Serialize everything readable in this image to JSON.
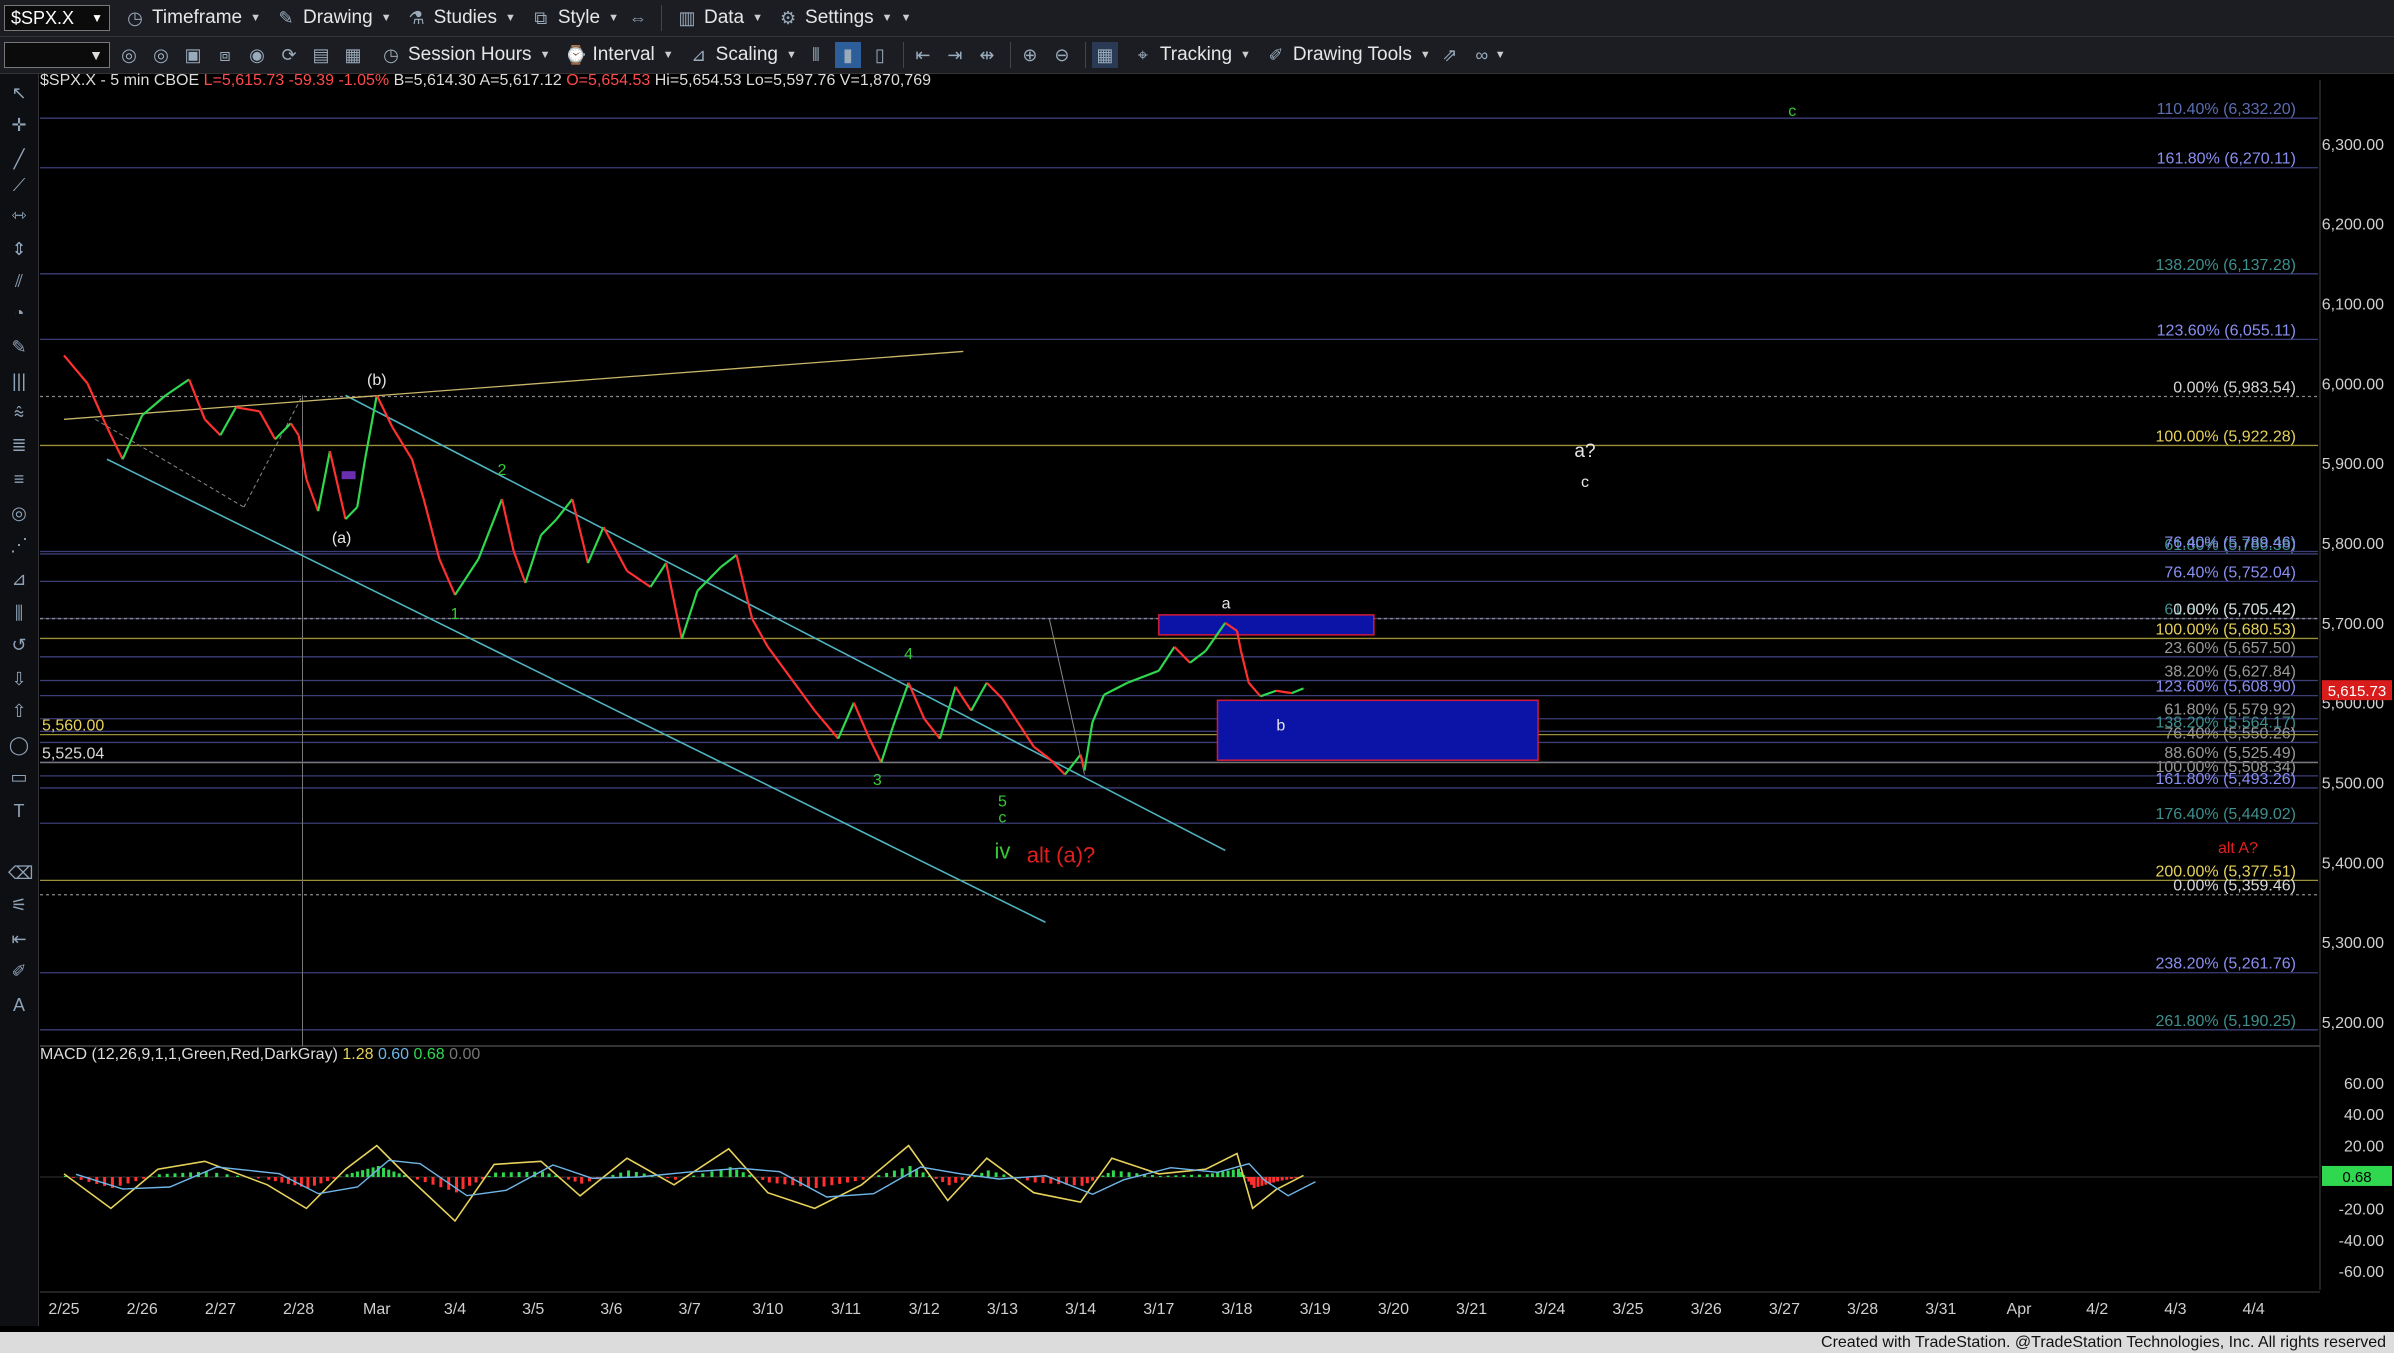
{
  "toolbar": {
    "symbol": "$SPX.X",
    "timeframe": "Timeframe",
    "drawing": "Drawing",
    "studies": "Studies",
    "style": "Style",
    "data": "Data",
    "settings": "Settings",
    "session_hours": "Session Hours",
    "interval": "Interval",
    "scaling": "Scaling",
    "tracking": "Tracking",
    "drawing_tools": "Drawing Tools"
  },
  "header": {
    "symbol_line": "$SPX.X - 5 min  CBOE",
    "last": "L=5,615.73",
    "change": "-59.39",
    "change_pct": "-1.05%",
    "bid": "B=5,614.30",
    "ask": "A=5,617.12",
    "open": "O=5,654.53",
    "high": "Hi=5,654.53",
    "low": "Lo=5,597.76",
    "volume": "V=1,870,769"
  },
  "colors": {
    "up": "#2fd84f",
    "down": "#ff3030",
    "trend": "#4fb3bf",
    "fib": "#3c3e78",
    "box": "#0c14a8",
    "box_edge": "#d01c3c",
    "label_white": "#e6e6e6",
    "label_green": "#37c837",
    "label_red": "#e02020",
    "price_tag": "#d81b1b",
    "macd_tag": "#2fd84f"
  },
  "chart_data": [
    {
      "type": "line",
      "title": "$SPX.X - 5 min",
      "x_ticks": [
        "2/25",
        "2/26",
        "2/27",
        "2/28",
        "Mar",
        "3/4",
        "3/5",
        "3/6",
        "3/7",
        "3/10",
        "3/11",
        "3/12",
        "3/13",
        "3/14",
        "3/17",
        "3/18",
        "3/19",
        "3/20",
        "3/21",
        "3/24",
        "3/25",
        "3/26",
        "3/27",
        "3/28",
        "3/31",
        "Apr",
        "4/2",
        "4/3",
        "4/4"
      ],
      "y_ticks": [
        5200,
        5300,
        5400,
        5500,
        5600,
        5700,
        5800,
        5900,
        6000,
        6100,
        6200,
        6300
      ],
      "y_tick_labels": [
        "5,200.00",
        "5,300.00",
        "5,400.00",
        "5,500.00",
        "5,600.00",
        "5,700.00",
        "5,800.00",
        "5,900.00",
        "6,000.00",
        "6,100.00",
        "6,200.00",
        "6,300.00"
      ],
      "ylim": [
        5170,
        6370
      ],
      "price_path": [
        {
          "x": 0.0,
          "y": 6035
        },
        {
          "x": 0.3,
          "y": 6000
        },
        {
          "x": 0.55,
          "y": 5945
        },
        {
          "x": 0.75,
          "y": 5905
        },
        {
          "x": 1.0,
          "y": 5960
        },
        {
          "x": 1.3,
          "y": 5985
        },
        {
          "x": 1.6,
          "y": 6005
        },
        {
          "x": 1.8,
          "y": 5955
        },
        {
          "x": 2.0,
          "y": 5935
        },
        {
          "x": 2.2,
          "y": 5970
        },
        {
          "x": 2.5,
          "y": 5965
        },
        {
          "x": 2.7,
          "y": 5930
        },
        {
          "x": 2.9,
          "y": 5950
        },
        {
          "x": 3.0,
          "y": 5935
        },
        {
          "x": 3.1,
          "y": 5880
        },
        {
          "x": 3.25,
          "y": 5840
        },
        {
          "x": 3.4,
          "y": 5915
        },
        {
          "x": 3.6,
          "y": 5830
        },
        {
          "x": 3.75,
          "y": 5845
        },
        {
          "x": 3.85,
          "y": 5905
        },
        {
          "x": 4.0,
          "y": 5985
        },
        {
          "x": 4.2,
          "y": 5945
        },
        {
          "x": 4.45,
          "y": 5905
        },
        {
          "x": 4.6,
          "y": 5855
        },
        {
          "x": 4.8,
          "y": 5780
        },
        {
          "x": 5.0,
          "y": 5735
        },
        {
          "x": 5.3,
          "y": 5780
        },
        {
          "x": 5.6,
          "y": 5855
        },
        {
          "x": 5.75,
          "y": 5790
        },
        {
          "x": 5.9,
          "y": 5750
        },
        {
          "x": 6.1,
          "y": 5810
        },
        {
          "x": 6.3,
          "y": 5830
        },
        {
          "x": 6.5,
          "y": 5855
        },
        {
          "x": 6.7,
          "y": 5775
        },
        {
          "x": 6.9,
          "y": 5820
        },
        {
          "x": 7.2,
          "y": 5765
        },
        {
          "x": 7.5,
          "y": 5745
        },
        {
          "x": 7.7,
          "y": 5775
        },
        {
          "x": 7.9,
          "y": 5680
        },
        {
          "x": 8.1,
          "y": 5740
        },
        {
          "x": 8.4,
          "y": 5770
        },
        {
          "x": 8.6,
          "y": 5785
        },
        {
          "x": 8.8,
          "y": 5705
        },
        {
          "x": 9.0,
          "y": 5670
        },
        {
          "x": 9.3,
          "y": 5630
        },
        {
          "x": 9.6,
          "y": 5590
        },
        {
          "x": 9.9,
          "y": 5555
        },
        {
          "x": 10.1,
          "y": 5600
        },
        {
          "x": 10.3,
          "y": 5555
        },
        {
          "x": 10.45,
          "y": 5525
        },
        {
          "x": 10.6,
          "y": 5570
        },
        {
          "x": 10.8,
          "y": 5625
        },
        {
          "x": 11.0,
          "y": 5580
        },
        {
          "x": 11.2,
          "y": 5555
        },
        {
          "x": 11.4,
          "y": 5620
        },
        {
          "x": 11.6,
          "y": 5590
        },
        {
          "x": 11.8,
          "y": 5625
        },
        {
          "x": 12.0,
          "y": 5605
        },
        {
          "x": 12.2,
          "y": 5575
        },
        {
          "x": 12.4,
          "y": 5545
        },
        {
          "x": 12.6,
          "y": 5530
        },
        {
          "x": 12.8,
          "y": 5510
        },
        {
          "x": 13.0,
          "y": 5535
        },
        {
          "x": 13.05,
          "y": 5515
        },
        {
          "x": 13.15,
          "y": 5575
        },
        {
          "x": 13.3,
          "y": 5610
        },
        {
          "x": 13.6,
          "y": 5625
        },
        {
          "x": 14.0,
          "y": 5640
        },
        {
          "x": 14.2,
          "y": 5670
        },
        {
          "x": 14.4,
          "y": 5650
        },
        {
          "x": 14.6,
          "y": 5665
        },
        {
          "x": 14.85,
          "y": 5700
        },
        {
          "x": 15.0,
          "y": 5690
        },
        {
          "x": 15.05,
          "y": 5665
        },
        {
          "x": 15.15,
          "y": 5625
        },
        {
          "x": 15.3,
          "y": 5608
        },
        {
          "x": 15.5,
          "y": 5615
        },
        {
          "x": 15.7,
          "y": 5612
        },
        {
          "x": 15.85,
          "y": 5618
        }
      ],
      "price_labels": [
        {
          "price": 6332.2,
          "label": "110.40% (6,332.20)",
          "color": "#5a6fb5"
        },
        {
          "price": 6270.11,
          "label": "161.80% (6,270.11)",
          "color": "#8a8ff2"
        },
        {
          "price": 6137.28,
          "label": "138.20% (6,137.28)",
          "color": "#3f8f8f"
        },
        {
          "price": 6055.11,
          "label": "123.60% (6,055.11)",
          "color": "#8a8ff2"
        },
        {
          "price": 5983.54,
          "label": "0.00% (5,983.54)",
          "color": "#d8d8d8"
        },
        {
          "price": 5922.28,
          "label": "100.00% (5,922.28)",
          "color": "#e6d25a"
        },
        {
          "price": 5786.38,
          "label": "61.80% (5,786.38)",
          "color": "#3f8f8f"
        },
        {
          "price": 5789.46,
          "label": "76.40% (5,789.46)",
          "color": "#8a8ff2"
        },
        {
          "price": 5752.04,
          "label": "76.40% (5,752.04)",
          "color": "#8a8ff2"
        },
        {
          "price": 5705.42,
          "label": "61.80% (5,705.42)",
          "color": "#3f8f8f"
        },
        {
          "price": 5705.42,
          "label": "0.00% (5,705.42)",
          "color": "#d8d8d8"
        },
        {
          "price": 5680.53,
          "label": "100.00% (5,680.53)",
          "color": "#e6d25a"
        },
        {
          "price": 5657.5,
          "label": "23.60% (5,657.50)",
          "color": "#9a9a9a"
        },
        {
          "price": 5627.84,
          "label": "38.20% (5,627.84)",
          "color": "#9a9a9a"
        },
        {
          "price": 5608.9,
          "label": "123.60% (5,608.90)",
          "color": "#8a8ff2"
        },
        {
          "price": 5579.92,
          "label": "61.80% (5,579.92)",
          "color": "#9a9a9a"
        },
        {
          "price": 5564.17,
          "label": "138.20% (5,564.17)",
          "color": "#3f8f8f"
        },
        {
          "price": 5550.26,
          "label": "76.40% (5,550.26)",
          "color": "#9a9a9a"
        },
        {
          "price": 5525.49,
          "label": "88.60% (5,525.49)",
          "color": "#9a9a9a"
        },
        {
          "price": 5508.34,
          "label": "100.00% (5,508.34)",
          "color": "#9a9a9a"
        },
        {
          "price": 5493.26,
          "label": "161.80% (5,493.26)",
          "color": "#8a8ff2"
        },
        {
          "price": 5449.02,
          "label": "176.40% (5,449.02)",
          "color": "#3f8f8f"
        },
        {
          "price": 5377.51,
          "label": "200.00% (5,377.51)",
          "color": "#e6d25a"
        },
        {
          "price": 5359.46,
          "label": "0.00% (5,359.46)",
          "color": "#d8d8d8"
        },
        {
          "price": 5261.76,
          "label": "238.20% (5,261.76)",
          "color": "#8a8ff2"
        },
        {
          "price": 5190.25,
          "label": "261.80% (5,190.25)",
          "color": "#3f8f8f"
        }
      ],
      "left_price_labels": [
        {
          "price": 5560.0,
          "label": "5,560.00",
          "color": "#e6d25a"
        },
        {
          "price": 5525.04,
          "label": "5,525.04",
          "color": "#d8d8d8"
        }
      ],
      "last_price_tag": "5,615.73",
      "wave_labels": [
        {
          "text": "(b)",
          "x": 4.0,
          "y": 5998,
          "color": "#e6e6e6"
        },
        {
          "text": "(a)",
          "x": 3.55,
          "y": 5800,
          "color": "#e6e6e6"
        },
        {
          "text": "1",
          "x": 5.0,
          "y": 5705,
          "color": "#37c837"
        },
        {
          "text": "2",
          "x": 5.6,
          "y": 5885,
          "color": "#37c837"
        },
        {
          "text": "3",
          "x": 10.4,
          "y": 5497,
          "color": "#37c837"
        },
        {
          "text": "4",
          "x": 10.8,
          "y": 5655,
          "color": "#37c837"
        },
        {
          "text": "5",
          "x": 12.0,
          "y": 5470,
          "color": "#37c837"
        },
        {
          "text": "c",
          "x": 12.0,
          "y": 5450,
          "color": "#37c837"
        },
        {
          "text": "iv",
          "x": 12.0,
          "y": 5405,
          "color": "#37c837"
        },
        {
          "text": "alt (a)?",
          "x": 12.75,
          "y": 5400,
          "color": "#e02020"
        },
        {
          "text": "a",
          "x": 14.86,
          "y": 5718,
          "color": "#e6e6e6"
        },
        {
          "text": "b",
          "x": 15.56,
          "y": 5565,
          "color": "#e6e6e6"
        },
        {
          "text": "a?",
          "x": 19.45,
          "y": 5908,
          "color": "#e6e6e6"
        },
        {
          "text": "c",
          "x": 19.45,
          "y": 5870,
          "color": "#e6e6e6"
        },
        {
          "text": "c",
          "x": 22.1,
          "y": 6335,
          "color": "#37c837"
        },
        {
          "text": "alt A?",
          "x": 27.8,
          "y": 5412,
          "color": "#e02020"
        }
      ],
      "boxes": [
        {
          "x0": 14.0,
          "x1": 16.75,
          "y0": 5685,
          "y1": 5710
        },
        {
          "x0": 14.75,
          "x1": 18.85,
          "y0": 5528,
          "y1": 5603
        }
      ]
    },
    {
      "type": "line",
      "title": "MACD (12,26,9,1,1,Green,Red,DarkGray)",
      "legend_values": [
        "1.28",
        "0.60",
        "0.68",
        "0.00"
      ],
      "y_ticks": [
        60,
        40,
        20,
        0,
        -20,
        -40,
        -60
      ],
      "y_tick_labels": [
        "60.00",
        "40.00",
        "20.00",
        "0.00",
        "-20.00",
        "-40.00",
        "-60.00"
      ],
      "ylim": [
        -72,
        72
      ],
      "macd_line": [
        {
          "x": 0.0,
          "y": 2
        },
        {
          "x": 0.6,
          "y": -20
        },
        {
          "x": 1.2,
          "y": 5
        },
        {
          "x": 1.8,
          "y": 10
        },
        {
          "x": 2.6,
          "y": -5
        },
        {
          "x": 3.1,
          "y": -20
        },
        {
          "x": 3.6,
          "y": 5
        },
        {
          "x": 4.0,
          "y": 20
        },
        {
          "x": 4.4,
          "y": 0
        },
        {
          "x": 5.0,
          "y": -28
        },
        {
          "x": 5.5,
          "y": 8
        },
        {
          "x": 6.1,
          "y": 10
        },
        {
          "x": 6.6,
          "y": -12
        },
        {
          "x": 7.2,
          "y": 12
        },
        {
          "x": 7.8,
          "y": -5
        },
        {
          "x": 8.5,
          "y": 18
        },
        {
          "x": 9.0,
          "y": -10
        },
        {
          "x": 9.6,
          "y": -20
        },
        {
          "x": 10.2,
          "y": -5
        },
        {
          "x": 10.8,
          "y": 20
        },
        {
          "x": 11.3,
          "y": -15
        },
        {
          "x": 11.8,
          "y": 12
        },
        {
          "x": 12.4,
          "y": -10
        },
        {
          "x": 13.0,
          "y": -16
        },
        {
          "x": 13.4,
          "y": 12
        },
        {
          "x": 14.0,
          "y": 2
        },
        {
          "x": 14.6,
          "y": 5
        },
        {
          "x": 15.0,
          "y": 15
        },
        {
          "x": 15.2,
          "y": -20
        },
        {
          "x": 15.5,
          "y": -8
        },
        {
          "x": 15.85,
          "y": 1
        }
      ],
      "last_value_tag": "0.68"
    }
  ],
  "footer": {
    "credit": "Created with TradeStation. @TradeStation Technologies, Inc. All rights reserved"
  }
}
